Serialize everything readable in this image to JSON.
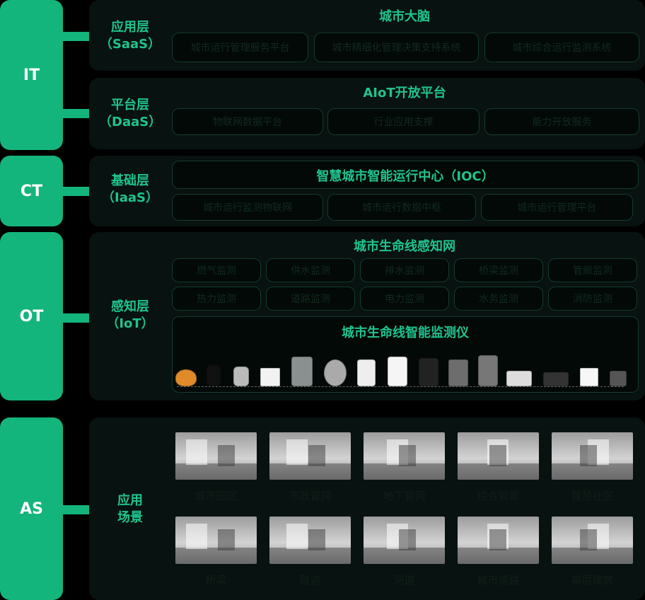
{
  "side_labels": {
    "it": "IT",
    "ct": "CT",
    "ot": "OT",
    "as": "AS"
  },
  "layers": {
    "saas": {
      "label": "应用层\n（SaaS）",
      "title": "城市大脑",
      "items": [
        "城市运行管理服务平台",
        "城市精细化管理决策支持系统",
        "城市综合运行监测系统"
      ]
    },
    "daas": {
      "label": "平台层\n（DaaS）",
      "title": "AIoT开放平台",
      "items": [
        "物联网数据平台",
        "行业应用支撑",
        "能力开放服务"
      ]
    },
    "iaas": {
      "label": "基础层\n（IaaS）",
      "title": "智慧城市智能运行中心（IOC）",
      "items": [
        "城市运行监测物联网",
        "城市运行数据中枢",
        "城市运行管理平台"
      ]
    },
    "iot": {
      "label": "感知层\n（IoT）",
      "title": "城市生命线感知网",
      "row1": [
        "燃气监测",
        "供水监测",
        "排水监测",
        "桥梁监测",
        "管廊监测"
      ],
      "row2": [
        "热力监测",
        "道路监测",
        "电力监测",
        "水务监测",
        "消防监测"
      ],
      "sub_title": "城市生命线智能监测仪",
      "devices": [
        "orange-dome-sensor",
        "black-cylinder-sensor",
        "metal-cylinder-sensor",
        "white-square-sensor",
        "gray-box-sensor",
        "round-silver-sensor",
        "white-box-sensor",
        "white-tall-sensor",
        "black-panel-sensor",
        "gray-tall-sensor",
        "dark-tall-sensor",
        "router-device",
        "gateway-device",
        "white-wall-sensor",
        "small-gray-sensor"
      ]
    },
    "scenes": {
      "label": "应用\n场景",
      "row1": [
        "城市园区",
        "市政管网",
        "地下管网",
        "综合管廊",
        "智慧社区"
      ],
      "row2": [
        "桥梁",
        "隧道",
        "河道",
        "城市道路",
        "高层建筑"
      ]
    }
  },
  "colors": {
    "accent": "#13b57d",
    "text": "#1fc38f",
    "panel": "#081210"
  }
}
